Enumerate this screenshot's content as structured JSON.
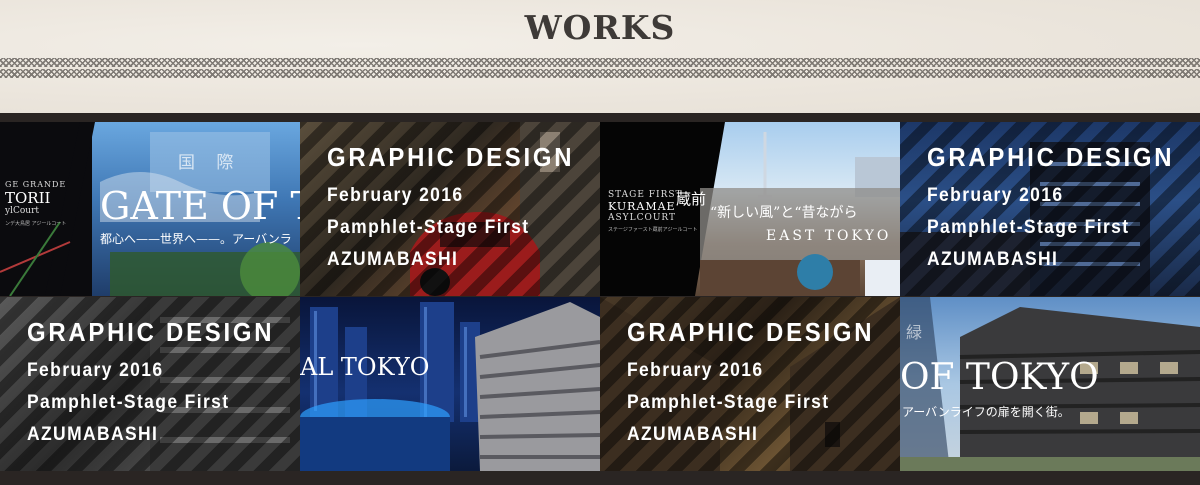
{
  "page": {
    "title": "WORKS"
  },
  "works": [
    {
      "category": "GRAPHIC DESIGN",
      "date": "February 2016",
      "title": "Pamphlet-Stage First",
      "place": "AZUMABASHI"
    },
    {
      "category": "GRAPHIC DESIGN",
      "date": "February 2016",
      "title": "Pamphlet-Stage First",
      "place": "AZUMABASHI"
    },
    {
      "category": "GRAPHIC DESIGN",
      "date": "February 2016",
      "title": "Pamphlet-Stage First",
      "place": "AZUMABASHI"
    },
    {
      "category": "GRAPHIC DESIGN",
      "date": "February 2016",
      "title": "Pamphlet-Stage First",
      "place": "AZUMABASHI"
    }
  ],
  "thumbs": {
    "t1": {
      "headline": "GATE OF T",
      "sub": "都心へ——世界へ——。アーバンラ",
      "logo_line1": "GE GRANDE",
      "logo_line2": "TORII",
      "logo_line3": "ylCourt",
      "logo_line4": "ンデ大鳥居 アジールコート"
    },
    "t3": {
      "logo_line1": "STAGE FIRST",
      "logo_line2": "KURAMAE",
      "logo_line3": "ASYLCOURT",
      "logo_kanji": "蔵前",
      "logo_line4": "ステージファースト蔵前アジールコート",
      "tagline": "“新しい風”と“昔ながら",
      "place": "EAST TOKYO"
    },
    "t6": {
      "headline": "AL TOKYO"
    },
    "t8": {
      "headline": "OF TOKYO",
      "sub": "アーバンライフの扉を開く街。"
    },
    "t1_sign": "国 際",
    "t8_sign": "緑"
  },
  "colors": {
    "title": "#3e3a37",
    "band": "#2a2523",
    "caption": "#ffffff"
  }
}
